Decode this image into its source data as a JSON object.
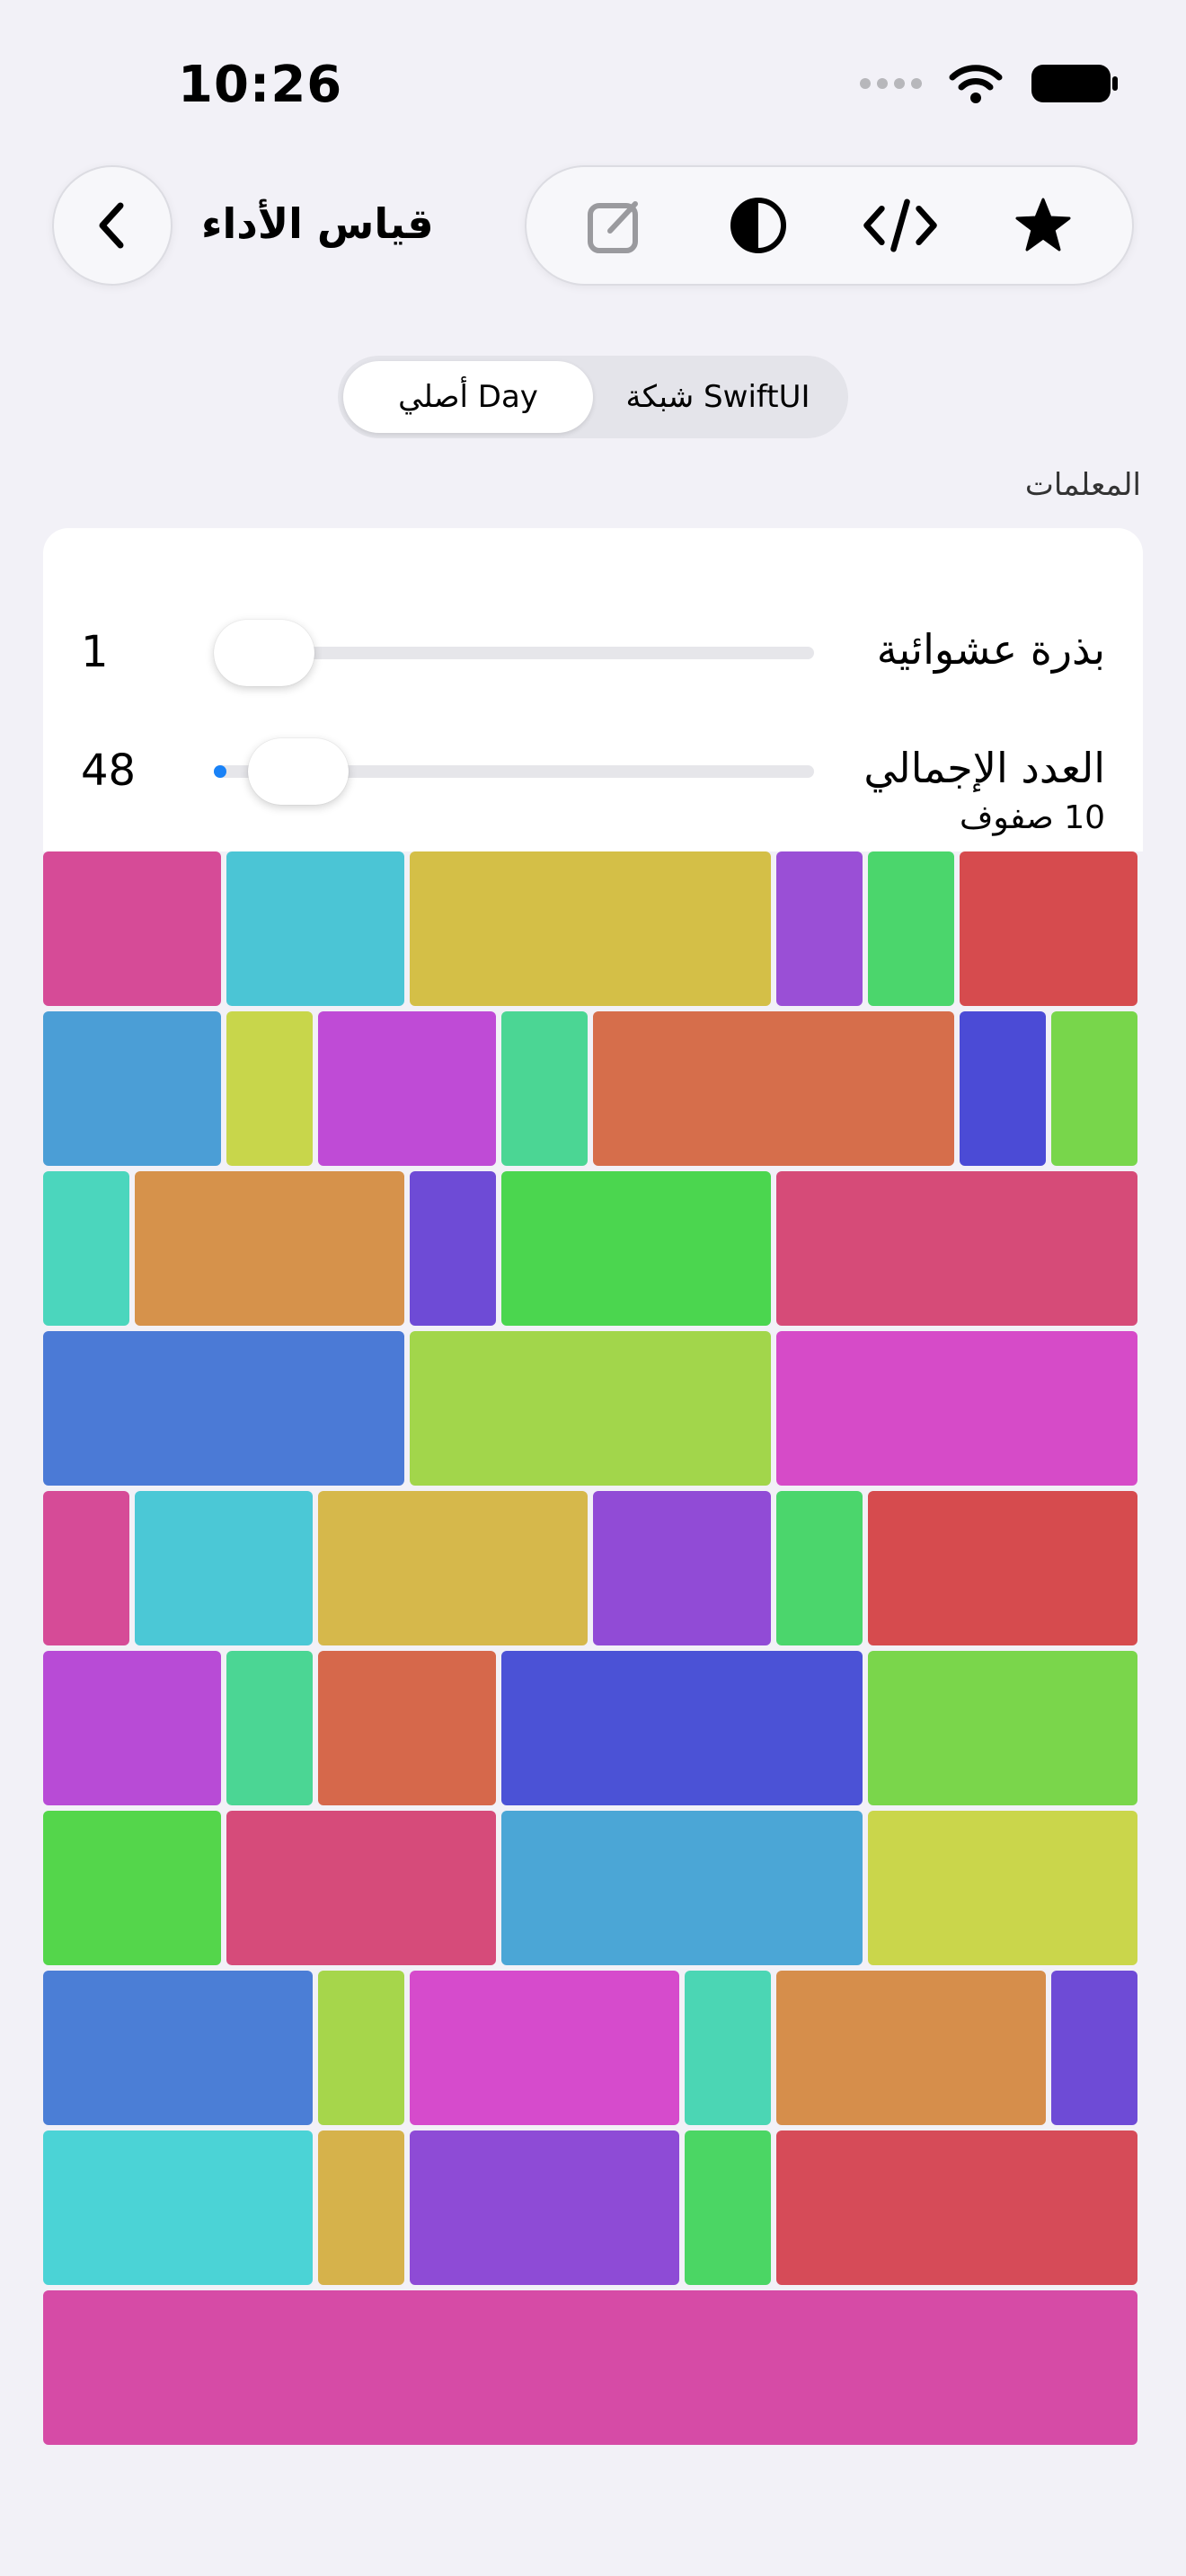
{
  "status_bar": {
    "time": "10:26"
  },
  "nav": {
    "title": "قياس الأداء",
    "back_icon": "chevron-left-icon"
  },
  "toolbar": {
    "icons": [
      "edit-icon",
      "contrast-icon",
      "code-icon",
      "star-icon"
    ]
  },
  "segmented": {
    "options": [
      "أصلي Day",
      "شبكة SwiftUI"
    ],
    "selected": "أصلي Day"
  },
  "section": {
    "title": "المعلمات"
  },
  "params": {
    "seed": {
      "label": "بذرة عشوائية",
      "value": "1",
      "fraction": 0.0
    },
    "total": {
      "label": "العدد الإجمالي",
      "value": "48",
      "fraction": 0.02
    },
    "rows_text": "10 صفوف"
  },
  "colors": {
    "accent": "#1982f7",
    "background": "#f2f1f7"
  },
  "grid": {
    "rows": [
      [
        {
          "w": 2,
          "c": "#d64b97"
        },
        {
          "w": 2,
          "c": "#4bc5d5"
        },
        {
          "w": 4,
          "c": "#d4bf47"
        },
        {
          "w": 1,
          "c": "#9a4fd6"
        },
        {
          "w": 1,
          "c": "#4bd66c"
        },
        {
          "w": 2,
          "c": "#d64b4e"
        }
      ],
      [
        {
          "w": 2,
          "c": "#4b9ed6"
        },
        {
          "w": 1,
          "c": "#c8d64b"
        },
        {
          "w": 2,
          "c": "#bf4bd6"
        },
        {
          "w": 1,
          "c": "#4bd694"
        },
        {
          "w": 4,
          "c": "#d66e4b"
        },
        {
          "w": 1,
          "c": "#4b4bd6"
        },
        {
          "w": 1,
          "c": "#78d64b"
        }
      ],
      [
        {
          "w": 1,
          "c": "#4bd6bd"
        },
        {
          "w": 3,
          "c": "#d6924b"
        },
        {
          "w": 1,
          "c": "#6e4bd6"
        },
        {
          "w": 3,
          "c": "#4bd64f"
        },
        {
          "w": 4,
          "c": "#d64b78"
        }
      ],
      [
        {
          "w": 4,
          "c": "#4b7ad6"
        },
        {
          "w": 4,
          "c": "#a2d64b"
        },
        {
          "w": 4,
          "c": "#d64bc8"
        }
      ],
      [
        {
          "w": 1,
          "c": "#d64b97"
        },
        {
          "w": 2,
          "c": "#4bc8d6"
        },
        {
          "w": 3,
          "c": "#d6b84b"
        },
        {
          "w": 2,
          "c": "#914bd6"
        },
        {
          "w": 1,
          "c": "#4bd66c"
        },
        {
          "w": 3,
          "c": "#d64b4e"
        }
      ],
      [
        {
          "w": 2,
          "c": "#b84bd6"
        },
        {
          "w": 1,
          "c": "#4bd694"
        },
        {
          "w": 2,
          "c": "#d6684b"
        },
        {
          "w": 4,
          "c": "#4b52d6"
        },
        {
          "w": 3,
          "c": "#7ad64b"
        }
      ],
      [
        {
          "w": 2,
          "c": "#54d64b"
        },
        {
          "w": 3,
          "c": "#d64b7a"
        },
        {
          "w": 4,
          "c": "#4ba6d6"
        },
        {
          "w": 3,
          "c": "#cad64b"
        }
      ],
      [
        {
          "w": 3,
          "c": "#4b7ed6"
        },
        {
          "w": 1,
          "c": "#a6d64b"
        },
        {
          "w": 3,
          "c": "#d64bcc"
        },
        {
          "w": 1,
          "c": "#4bd6b4"
        },
        {
          "w": 3,
          "c": "#d68e4b"
        },
        {
          "w": 1,
          "c": "#6e4bd6"
        }
      ],
      [
        {
          "w": 3,
          "c": "#4bd3d6"
        },
        {
          "w": 1,
          "c": "#d6b24b"
        },
        {
          "w": 3,
          "c": "#8e4bd6"
        },
        {
          "w": 1,
          "c": "#4bd664"
        },
        {
          "w": 4,
          "c": "#d64b58"
        }
      ],
      [
        {
          "w": 12,
          "c": "#d64ba6"
        }
      ]
    ]
  }
}
